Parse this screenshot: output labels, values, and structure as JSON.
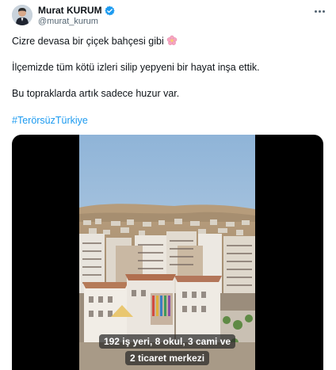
{
  "author": {
    "display_name": "Murat KURUM",
    "handle": "@murat_kurum",
    "verified_icon": "verified-badge-icon",
    "avatar_icon": "avatar"
  },
  "menu": {
    "icon": "more-options-icon"
  },
  "tweet": {
    "line1": "Cizre devasa bir çiçek bahçesi gibi",
    "line1_emoji": "cherry-blossom-icon",
    "line2": "İlçemizde tüm kötü izleri silip yepyeni bir hayat inşa ettik.",
    "line3": "Bu topraklarda artık sadece huzur var.",
    "hashtag": "#TerörsüzTürkiye"
  },
  "video": {
    "caption_line1": "192 iş yeri, 8 okul, 3 cami ve",
    "caption_line2": "2 ticaret merkezi"
  },
  "colors": {
    "link": "#1d9bf0",
    "verified": "#1d9bf0",
    "handle": "#536471",
    "text": "#0f1419"
  }
}
